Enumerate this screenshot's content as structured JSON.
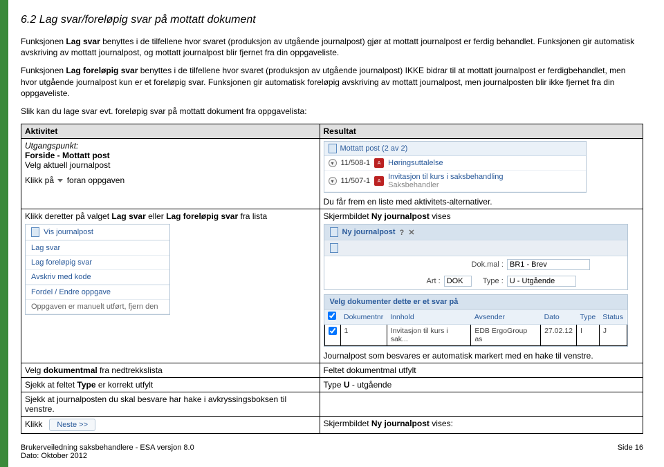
{
  "section": {
    "number": "6.2",
    "title": "Lag svar/foreløpig svar på mottatt dokument"
  },
  "paragraphs": {
    "p1_a": "Funksjonen ",
    "p1_b": "Lag svar",
    "p1_c": " benyttes i de tilfellene hvor svaret (produksjon av utgående journalpost) gjør at mottatt journalpost er ferdig behandlet. Funksjonen gir automatisk avskriving av mottatt journalpost, og mottatt journalpost blir fjernet fra din oppgaveliste.",
    "p2_a": "Funksjonen ",
    "p2_b": "Lag foreløpig svar",
    "p2_c": " benyttes i de tilfellene hvor svaret (produksjon av utgående journalpost) IKKE bidrar til at mottatt journalpost er ferdigbehandlet, men hvor utgående journalpost kun er et foreløpig svar. Funksjonen gir automatisk foreløpig avskriving av mottatt journalpost, men journalposten blir ikke fjernet fra din oppgaveliste.",
    "p3": "Slik kan du lage svar evt. foreløpig svar på mottatt dokument fra oppgavelista:"
  },
  "table": {
    "headers": {
      "activity": "Aktivitet",
      "result": "Resultat"
    },
    "row1": {
      "starting_point_label": "Utgangspunkt:",
      "starting_point": "Forside - Mottatt post",
      "select_jp": "Velg aktuell journalpost",
      "click_prefix": "Klikk på",
      "click_suffix": "foran oppgaven"
    },
    "row1_result_below": "Du får frem en liste med aktivitets-alternativer.",
    "row2": {
      "act_a": "Klikk deretter på valget ",
      "act_b": "Lag svar",
      "act_c": " eller ",
      "act_d": "Lag foreløpig svar",
      "act_e": " fra lista"
    },
    "row2_result_a": "Skjermbildet ",
    "row2_result_b": "Ny journalpost",
    "row2_result_c": " vises",
    "row2_result_below": "Journalpost som besvares er automatisk markert med en hake til venstre.",
    "row3": {
      "act_a": "Velg ",
      "act_b": "dokumentmal",
      "act_c": " fra nedtrekkslista",
      "res": "Feltet dokumentmal utfylt"
    },
    "row4": {
      "act_a": "Sjekk at feltet ",
      "act_b": "Type",
      "act_c": " er korrekt utfylt",
      "res_a": "Type ",
      "res_b": "U",
      "res_c": " - utgående"
    },
    "row5": {
      "act": "Sjekk at journalposten du skal besvare har hake i avkryssingsboksen til venstre."
    },
    "row6": {
      "act": "Klikk",
      "res_a": "Skjermbildet ",
      "res_b": "Ny journalpost",
      "res_c": " vises:"
    }
  },
  "shots": {
    "post": {
      "head": "Mottatt post (2 av 2)",
      "r1_num": "11/508-1",
      "r1_title": "Høringsuttalelse",
      "r2_num": "11/507-1",
      "r2_title_a": "Invitasjon til kurs i saksbehandling",
      "r2_title_b": "Saksbehandler"
    },
    "menu": {
      "m0": "Vis journalpost",
      "m1": "Lag svar",
      "m2": "Lag foreløpig svar",
      "m3": "Avskriv med kode",
      "m4": "Fordel / Endre oppgave",
      "m5": "Oppgaven er manuelt utført, fjern den"
    },
    "jp": {
      "title": "Ny journalpost",
      "dokmal_lbl": "Dok.mal :",
      "dokmal_val": "BR1 - Brev",
      "art_lbl": "Art :",
      "art_val": "DOK",
      "type_lbl": "Type :",
      "type_val": "U - Utgående"
    },
    "docsel": {
      "title": "Velg dokumenter dette er et svar på",
      "th1": "Dokumentnr",
      "th2": "Innhold",
      "th3": "Avsender",
      "th4": "Dato",
      "th5": "Type",
      "th6": "Status",
      "td1": "1",
      "td2": "Invitasjon til kurs i sak...",
      "td3": "EDB ErgoGroup as",
      "td4": "27.02.12",
      "td5": "I",
      "td6": "J"
    },
    "neste": "Neste >>"
  },
  "footer": {
    "left_a": "Brukerveiledning saksbehandlere - ESA versjon 8.0",
    "left_b": "Dato: Oktober 2012",
    "right": "Side 16"
  }
}
